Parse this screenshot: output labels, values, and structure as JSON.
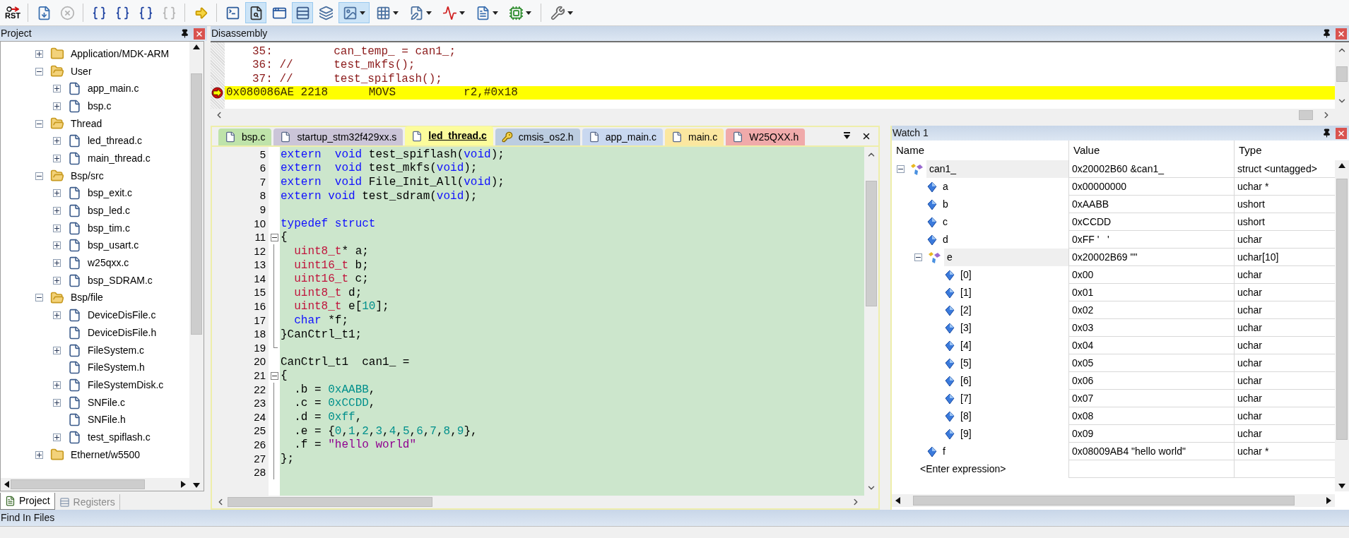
{
  "toolbar": [
    {
      "kind": "rst",
      "label": "RST"
    },
    {
      "kind": "separator"
    },
    {
      "kind": "button",
      "selected": false,
      "disabled": false,
      "dropdown": false
    },
    {
      "kind": "button",
      "selected": false,
      "disabled": true,
      "dropdown": false
    },
    {
      "kind": "separator"
    },
    {
      "kind": "button",
      "selected": false,
      "disabled": false,
      "dropdown": false
    },
    {
      "kind": "button",
      "selected": false,
      "disabled": false,
      "dropdown": false
    },
    {
      "kind": "button",
      "selected": false,
      "disabled": false,
      "dropdown": false
    },
    {
      "kind": "button",
      "selected": false,
      "disabled": true,
      "dropdown": false
    },
    {
      "kind": "separator"
    },
    {
      "kind": "button",
      "selected": false,
      "disabled": false,
      "dropdown": false
    },
    {
      "kind": "separator"
    },
    {
      "kind": "button",
      "selected": false,
      "disabled": false,
      "dropdown": false
    },
    {
      "kind": "button",
      "selected": true,
      "disabled": false,
      "dropdown": false
    },
    {
      "kind": "button",
      "selected": false,
      "disabled": false,
      "dropdown": false
    },
    {
      "kind": "button",
      "selected": true,
      "disabled": false,
      "dropdown": false
    },
    {
      "kind": "button",
      "selected": false,
      "disabled": false,
      "dropdown": false
    },
    {
      "kind": "button",
      "selected": true,
      "disabled": false,
      "dropdown": true
    },
    {
      "kind": "button",
      "selected": false,
      "disabled": false,
      "dropdown": true
    },
    {
      "kind": "button",
      "selected": false,
      "disabled": false,
      "dropdown": true
    },
    {
      "kind": "button",
      "selected": false,
      "disabled": false,
      "dropdown": true
    },
    {
      "kind": "button",
      "selected": false,
      "disabled": false,
      "dropdown": true
    },
    {
      "kind": "button",
      "selected": false,
      "disabled": false,
      "dropdown": true
    },
    {
      "kind": "separator"
    },
    {
      "kind": "button",
      "selected": false,
      "disabled": false,
      "dropdown": true
    }
  ],
  "project": {
    "title": "Project",
    "tree": [
      {
        "label": "Application/MDK-ARM",
        "kind": "folder",
        "expanded": false
      },
      {
        "label": "User",
        "kind": "folder",
        "expanded": true,
        "children": [
          {
            "label": "app_main.c",
            "kind": "file",
            "expanded": false
          },
          {
            "label": "bsp.c",
            "kind": "file",
            "expanded": false
          }
        ]
      },
      {
        "label": "Thread",
        "kind": "folder",
        "expanded": true,
        "children": [
          {
            "label": "led_thread.c",
            "kind": "file",
            "expanded": false
          },
          {
            "label": "main_thread.c",
            "kind": "file",
            "expanded": false
          }
        ]
      },
      {
        "label": "Bsp/src",
        "kind": "folder",
        "expanded": true,
        "children": [
          {
            "label": "bsp_exit.c",
            "kind": "file",
            "expanded": false
          },
          {
            "label": "bsp_led.c",
            "kind": "file",
            "expanded": false
          },
          {
            "label": "bsp_tim.c",
            "kind": "file",
            "expanded": false
          },
          {
            "label": "bsp_usart.c",
            "kind": "file",
            "expanded": false
          },
          {
            "label": "w25qxx.c",
            "kind": "file",
            "expanded": false
          },
          {
            "label": "bsp_SDRAM.c",
            "kind": "file",
            "expanded": false
          }
        ]
      },
      {
        "label": "Bsp/file",
        "kind": "folder",
        "expanded": true,
        "children": [
          {
            "label": "DeviceDisFile.c",
            "kind": "file",
            "expanded": false
          },
          {
            "label": "DeviceDisFile.h",
            "kind": "leaf"
          },
          {
            "label": "FileSystem.c",
            "kind": "file",
            "expanded": false
          },
          {
            "label": "FileSystem.h",
            "kind": "leaf"
          },
          {
            "label": "FileSystemDisk.c",
            "kind": "file",
            "expanded": false
          },
          {
            "label": "SNFile.c",
            "kind": "file",
            "expanded": false
          },
          {
            "label": "SNFile.h",
            "kind": "leaf"
          },
          {
            "label": "test_spiflash.c",
            "kind": "file",
            "expanded": false
          }
        ]
      },
      {
        "label": "Ethernet/w5500",
        "kind": "folder",
        "expanded": false
      }
    ],
    "tabs": [
      {
        "label": "Project",
        "selected": true
      },
      {
        "label": "Registers",
        "selected": false
      }
    ]
  },
  "disassembly": {
    "title": "Disassembly",
    "lines": [
      {
        "kind": "source",
        "text": "35:         can_temp_ = can1_;",
        "current": false
      },
      {
        "kind": "source",
        "text": "36: //      test_mkfs();",
        "current": false
      },
      {
        "kind": "source",
        "text": "37: //      test_spiflash();",
        "current": false
      },
      {
        "kind": "instruction",
        "text": "0x080086AE 2218      MOVS          r2,#0x18",
        "current": true
      }
    ]
  },
  "editor": {
    "tabs": [
      {
        "label": "bsp.c",
        "color": "#bfe3aa",
        "selected": false,
        "read_only": false
      },
      {
        "label": "startup_stm32f429xx.s",
        "color": "#cbc5d8",
        "selected": false,
        "read_only": false
      },
      {
        "label": "led_thread.c",
        "color": "#fcfc9c",
        "selected": true,
        "read_only": false
      },
      {
        "label": "cmsis_os2.h",
        "color": "#bccde0",
        "selected": false,
        "read_only": true
      },
      {
        "label": "app_main.c",
        "color": "#c9d8f0",
        "selected": false,
        "read_only": false
      },
      {
        "label": "main.c",
        "color": "#fbe7a0",
        "selected": false,
        "read_only": false
      },
      {
        "label": "W25QXX.h",
        "color": "#f0aaaa",
        "selected": false,
        "read_only": false
      }
    ],
    "lines": [
      {
        "number": "5",
        "tokens": [
          {
            "kind": "keyword",
            "text": "extern"
          },
          {
            "kind": "keyword",
            "text": "  void"
          },
          {
            "kind": "plain",
            "text": " test_spiflash("
          },
          {
            "kind": "keyword",
            "text": "void"
          },
          {
            "kind": "plain",
            "text": ");"
          }
        ]
      },
      {
        "number": "6",
        "tokens": [
          {
            "kind": "keyword",
            "text": "extern"
          },
          {
            "kind": "keyword",
            "text": "  void"
          },
          {
            "kind": "plain",
            "text": " test_mkfs("
          },
          {
            "kind": "keyword",
            "text": "void"
          },
          {
            "kind": "plain",
            "text": ");"
          }
        ]
      },
      {
        "number": "7",
        "tokens": [
          {
            "kind": "keyword",
            "text": "extern"
          },
          {
            "kind": "keyword",
            "text": "  void"
          },
          {
            "kind": "plain",
            "text": " File_Init_All("
          },
          {
            "kind": "keyword",
            "text": "void"
          },
          {
            "kind": "plain",
            "text": ");"
          }
        ]
      },
      {
        "number": "8",
        "tokens": [
          {
            "kind": "keyword",
            "text": "extern"
          },
          {
            "kind": "keyword",
            "text": " void"
          },
          {
            "kind": "plain",
            "text": " test_sdram("
          },
          {
            "kind": "keyword",
            "text": "void"
          },
          {
            "kind": "plain",
            "text": ");"
          }
        ]
      },
      {
        "number": "9"
      },
      {
        "number": "10",
        "tokens": [
          {
            "kind": "keyword",
            "text": "typedef"
          },
          {
            "kind": "keyword",
            "text": " struct"
          }
        ]
      },
      {
        "number": "11",
        "fold": {
          "kind": "open"
        },
        "tokens": [
          {
            "kind": "plain",
            "text": "{"
          }
        ]
      },
      {
        "number": "12",
        "fold": {
          "kind": "body"
        },
        "tokens": [
          {
            "kind": "type",
            "text": "  uint8_t"
          },
          {
            "kind": "plain",
            "text": "* a;"
          }
        ]
      },
      {
        "number": "13",
        "fold": {
          "kind": "body"
        },
        "tokens": [
          {
            "kind": "type",
            "text": "  uint16_t"
          },
          {
            "kind": "plain",
            "text": " b;"
          }
        ]
      },
      {
        "number": "14",
        "fold": {
          "kind": "body"
        },
        "tokens": [
          {
            "kind": "type",
            "text": "  uint16_t"
          },
          {
            "kind": "plain",
            "text": " c;"
          }
        ]
      },
      {
        "number": "15",
        "fold": {
          "kind": "body"
        },
        "tokens": [
          {
            "kind": "type",
            "text": "  uint8_t"
          },
          {
            "kind": "plain",
            "text": " d;"
          }
        ]
      },
      {
        "number": "16",
        "fold": {
          "kind": "body"
        },
        "tokens": [
          {
            "kind": "type",
            "text": "  uint8_t"
          },
          {
            "kind": "plain",
            "text": " e["
          },
          {
            "kind": "number",
            "text": "10"
          },
          {
            "kind": "plain",
            "text": "];"
          }
        ]
      },
      {
        "number": "17",
        "fold": {
          "kind": "body"
        },
        "tokens": [
          {
            "kind": "keyword",
            "text": "  char"
          },
          {
            "kind": "plain",
            "text": " *f;"
          }
        ]
      },
      {
        "number": "18",
        "fold": {
          "kind": "body"
        },
        "tokens": [
          {
            "kind": "plain",
            "text": "}CanCtrl_t1;"
          }
        ]
      },
      {
        "number": "19",
        "fold": {
          "kind": "end"
        }
      },
      {
        "number": "20",
        "tokens": [
          {
            "kind": "plain",
            "text": "CanCtrl_t1  can1_ ="
          }
        ]
      },
      {
        "number": "21",
        "fold": {
          "kind": "open"
        },
        "tokens": [
          {
            "kind": "plain",
            "text": "{"
          }
        ]
      },
      {
        "number": "22",
        "fold": {
          "kind": "body"
        },
        "tokens": [
          {
            "kind": "plain",
            "text": "  .b = "
          },
          {
            "kind": "number",
            "text": "0xAABB"
          },
          {
            "kind": "plain",
            "text": ","
          }
        ]
      },
      {
        "number": "23",
        "fold": {
          "kind": "body"
        },
        "tokens": [
          {
            "kind": "plain",
            "text": "  .c = "
          },
          {
            "kind": "number",
            "text": "0xCCDD"
          },
          {
            "kind": "plain",
            "text": ","
          }
        ]
      },
      {
        "number": "24",
        "fold": {
          "kind": "body"
        },
        "tokens": [
          {
            "kind": "plain",
            "text": "  .d = "
          },
          {
            "kind": "number",
            "text": "0xff"
          },
          {
            "kind": "plain",
            "text": ","
          }
        ]
      },
      {
        "number": "25",
        "fold": {
          "kind": "body"
        },
        "tokens": [
          {
            "kind": "plain",
            "text": "  .e = {"
          },
          {
            "kind": "number",
            "text": "0"
          },
          {
            "kind": "plain",
            "text": ","
          },
          {
            "kind": "number",
            "text": "1"
          },
          {
            "kind": "plain",
            "text": ","
          },
          {
            "kind": "number",
            "text": "2"
          },
          {
            "kind": "plain",
            "text": ","
          },
          {
            "kind": "number",
            "text": "3"
          },
          {
            "kind": "plain",
            "text": ","
          },
          {
            "kind": "number",
            "text": "4"
          },
          {
            "kind": "plain",
            "text": ","
          },
          {
            "kind": "number",
            "text": "5"
          },
          {
            "kind": "plain",
            "text": ","
          },
          {
            "kind": "number",
            "text": "6"
          },
          {
            "kind": "plain",
            "text": ","
          },
          {
            "kind": "number",
            "text": "7"
          },
          {
            "kind": "plain",
            "text": ","
          },
          {
            "kind": "number",
            "text": "8"
          },
          {
            "kind": "plain",
            "text": ","
          },
          {
            "kind": "number",
            "text": "9"
          },
          {
            "kind": "plain",
            "text": "},"
          }
        ]
      },
      {
        "number": "26",
        "fold": {
          "kind": "body"
        },
        "tokens": [
          {
            "kind": "plain",
            "text": "  .f = "
          },
          {
            "kind": "string",
            "text": "\"hello world\""
          }
        ]
      },
      {
        "number": "27",
        "fold": {
          "kind": "body"
        },
        "tokens": [
          {
            "kind": "plain",
            "text": "};"
          }
        ]
      },
      {
        "number": "28",
        "fold": {
          "kind": "body"
        }
      }
    ]
  },
  "watch": {
    "title": "Watch 1",
    "columns": [
      "Name",
      "Value",
      "Type"
    ],
    "rows": [
      {
        "name": "can1_",
        "value": "0x20002B60 &can1_",
        "type": "struct <untagged>",
        "kind": "struct",
        "expanded": true,
        "children": [
          {
            "name": "a",
            "value": "0x00000000",
            "type": "uchar *",
            "kind": "member"
          },
          {
            "name": "b",
            "value": "0xAABB",
            "type": "ushort",
            "kind": "member"
          },
          {
            "name": "c",
            "value": "0xCCDD",
            "type": "ushort",
            "kind": "member"
          },
          {
            "name": "d",
            "value": "0xFF '   '",
            "type": "uchar",
            "kind": "member"
          },
          {
            "name": "e",
            "value": "0x20002B69 \"\"",
            "type": "uchar[10]",
            "kind": "struct",
            "expanded": true,
            "children": [
              {
                "name": "[0]",
                "value": "0x00",
                "type": "uchar",
                "kind": "member"
              },
              {
                "name": "[1]",
                "value": "0x01",
                "type": "uchar",
                "kind": "member"
              },
              {
                "name": "[2]",
                "value": "0x02",
                "type": "uchar",
                "kind": "member"
              },
              {
                "name": "[3]",
                "value": "0x03",
                "type": "uchar",
                "kind": "member"
              },
              {
                "name": "[4]",
                "value": "0x04",
                "type": "uchar",
                "kind": "member"
              },
              {
                "name": "[5]",
                "value": "0x05",
                "type": "uchar",
                "kind": "member"
              },
              {
                "name": "[6]",
                "value": "0x06",
                "type": "uchar",
                "kind": "member"
              },
              {
                "name": "[7]",
                "value": "0x07",
                "type": "uchar",
                "kind": "member"
              },
              {
                "name": "[8]",
                "value": "0x08",
                "type": "uchar",
                "kind": "member"
              },
              {
                "name": "[9]",
                "value": "0x09",
                "type": "uchar",
                "kind": "member"
              }
            ]
          },
          {
            "name": "f",
            "value": "0x08009AB4 \"hello world\"",
            "type": "uchar *",
            "kind": "member"
          }
        ]
      }
    ],
    "enter_expression": "<Enter expression>"
  },
  "find_in_files": {
    "title": "Find In Files"
  }
}
